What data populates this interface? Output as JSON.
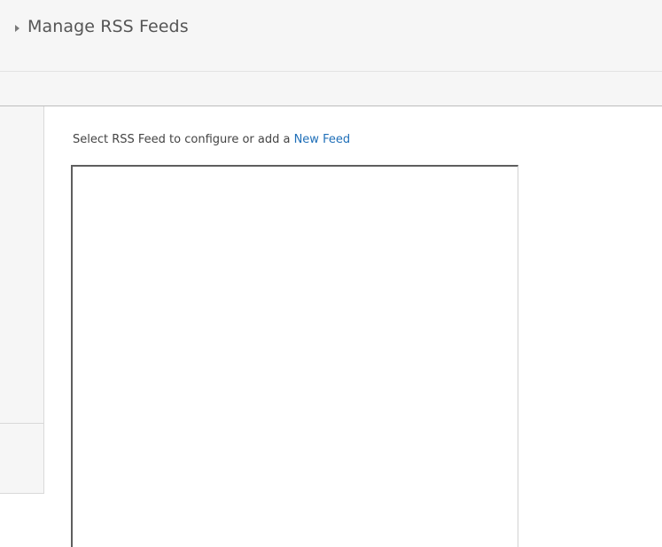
{
  "header": {
    "title": "Manage RSS Feeds"
  },
  "main": {
    "instruction_prefix": "Select RSS Feed to configure or add a ",
    "new_feed_link": "New Feed",
    "feed_list": {
      "items": []
    }
  },
  "colors": {
    "link": "#1f6fb8",
    "panel_background": "#f6f6f6",
    "title_text": "#555555"
  }
}
